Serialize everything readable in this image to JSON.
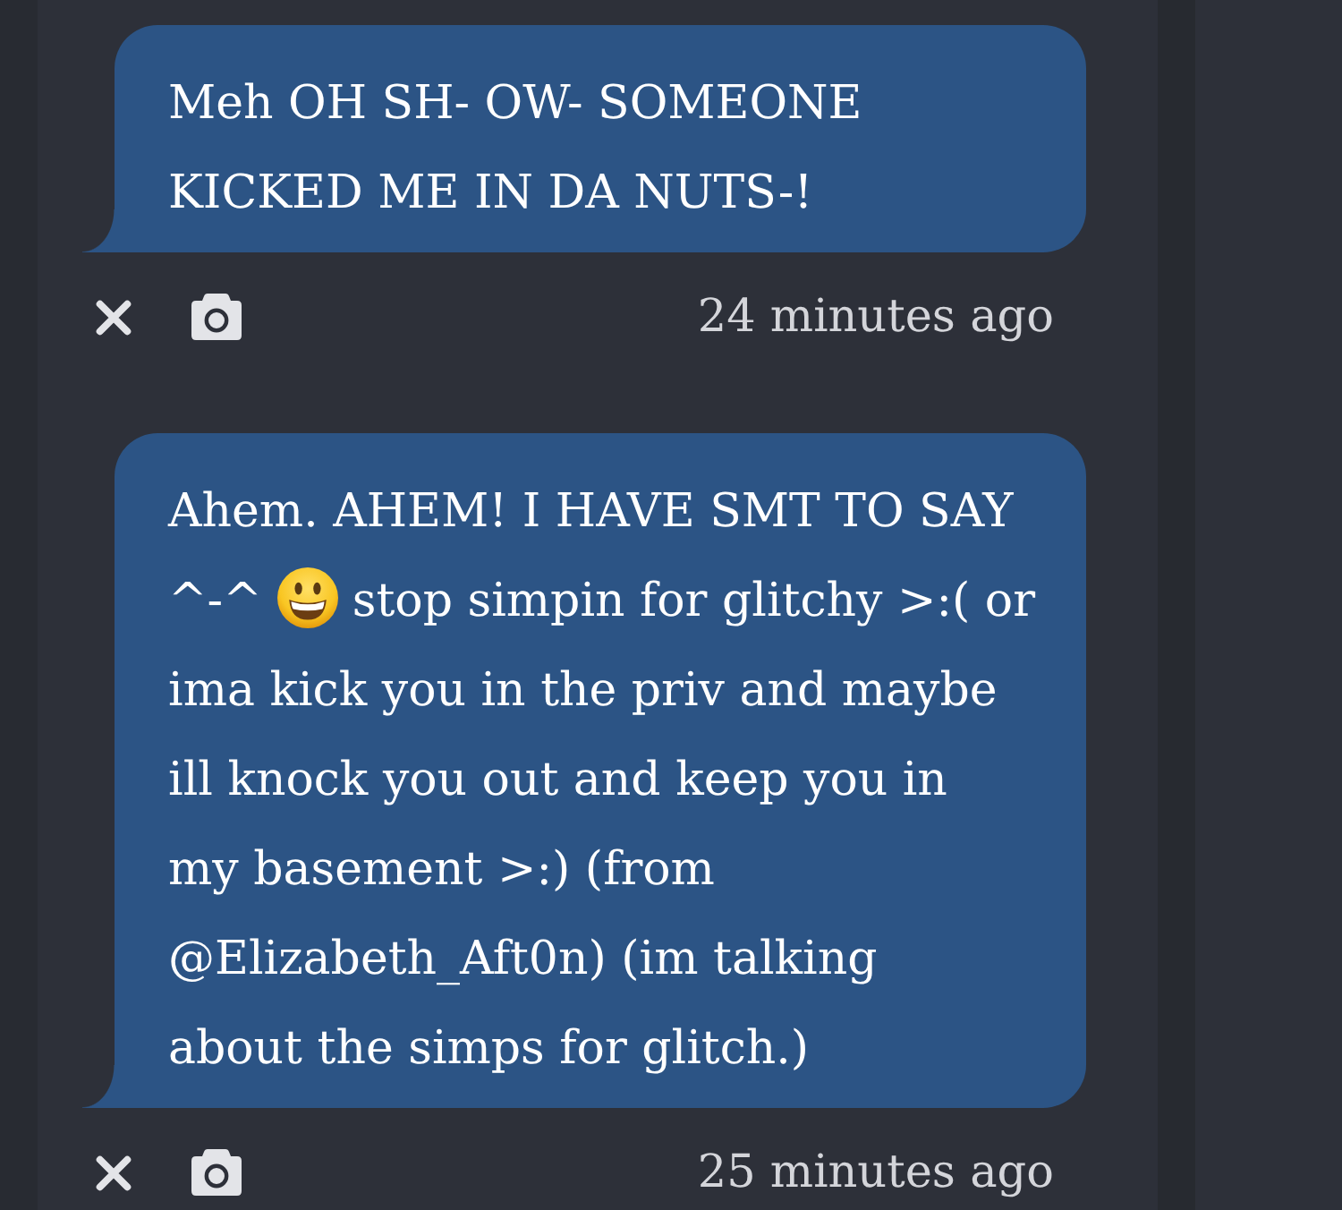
{
  "messages": [
    {
      "parts": [
        {
          "kind": "text",
          "text": "Meh OH SH- OW- SOMEONE\nKICKED ME IN DA NUTS-!"
        }
      ],
      "time": "24 minutes ago"
    },
    {
      "parts": [
        {
          "kind": "text",
          "text": "Ahem. AHEM! I HAVE SMT TO SAY\n^-^"
        },
        {
          "kind": "emoji"
        },
        {
          "kind": "text",
          "text": "stop simpin for glitchy >:( or\nima kick you in the priv and maybe\nill knock you out and keep you in\nmy basement >:) (from\n@Elizabeth_Aft0n) (im talking\nabout the simps for glitch.)"
        }
      ],
      "time": "25 minutes ago"
    }
  ]
}
